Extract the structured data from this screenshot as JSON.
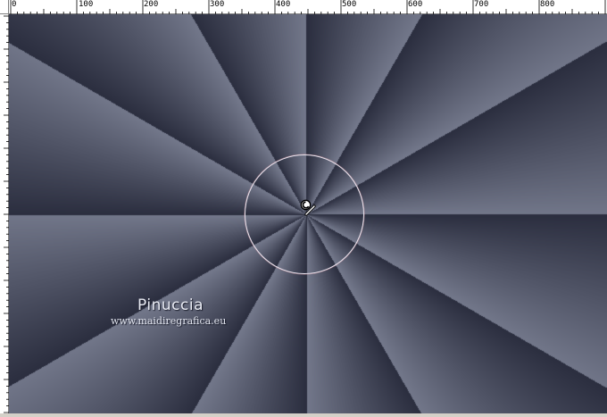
{
  "ruler": {
    "top_labels": [
      "0",
      "100",
      "200",
      "300",
      "400",
      "500",
      "600",
      "700",
      "800"
    ]
  },
  "canvas": {
    "colors": {
      "dark": "#2b2e3f",
      "light": "#767b8e"
    }
  },
  "watermark": {
    "name": "Pinuccia",
    "url": "www.maidiregrafica.eu"
  },
  "icons": {
    "tool_cursor": "radial-gradient-tool-cursor-icon"
  }
}
